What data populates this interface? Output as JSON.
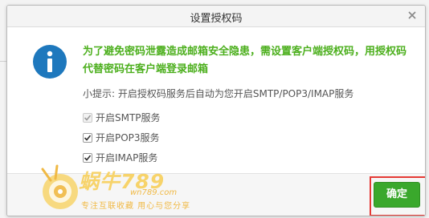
{
  "dialog": {
    "title": "设置授权码",
    "message": "为了避免密码泄露造成邮箱安全隐患，需设置客户端授权码，用授权码代替密码在客户端登录邮箱",
    "hint": "小提示: 开启授权码服务后自动为您开启SMTP/POP3/IMAP服务",
    "options": [
      {
        "label": "开启SMTP服务",
        "checked": true,
        "disabled": true
      },
      {
        "label": "开启POP3服务",
        "checked": true,
        "disabled": false
      },
      {
        "label": "开启IMAP服务",
        "checked": true,
        "disabled": false
      }
    ],
    "ok_label": "确定"
  },
  "watermark": {
    "brand": "蜗牛789",
    "url": "wn789.com",
    "slogan": "专注互联收藏   用心与您分享"
  },
  "colors": {
    "message_green": "#4caf1d",
    "button_green": "#3aa82c",
    "info_blue": "#1e78bd",
    "highlight_red": "#e53935",
    "watermark_gold": "#f0b945"
  },
  "icons": {
    "close": "close-icon",
    "info": "info-icon",
    "check": "checkmark-icon"
  }
}
